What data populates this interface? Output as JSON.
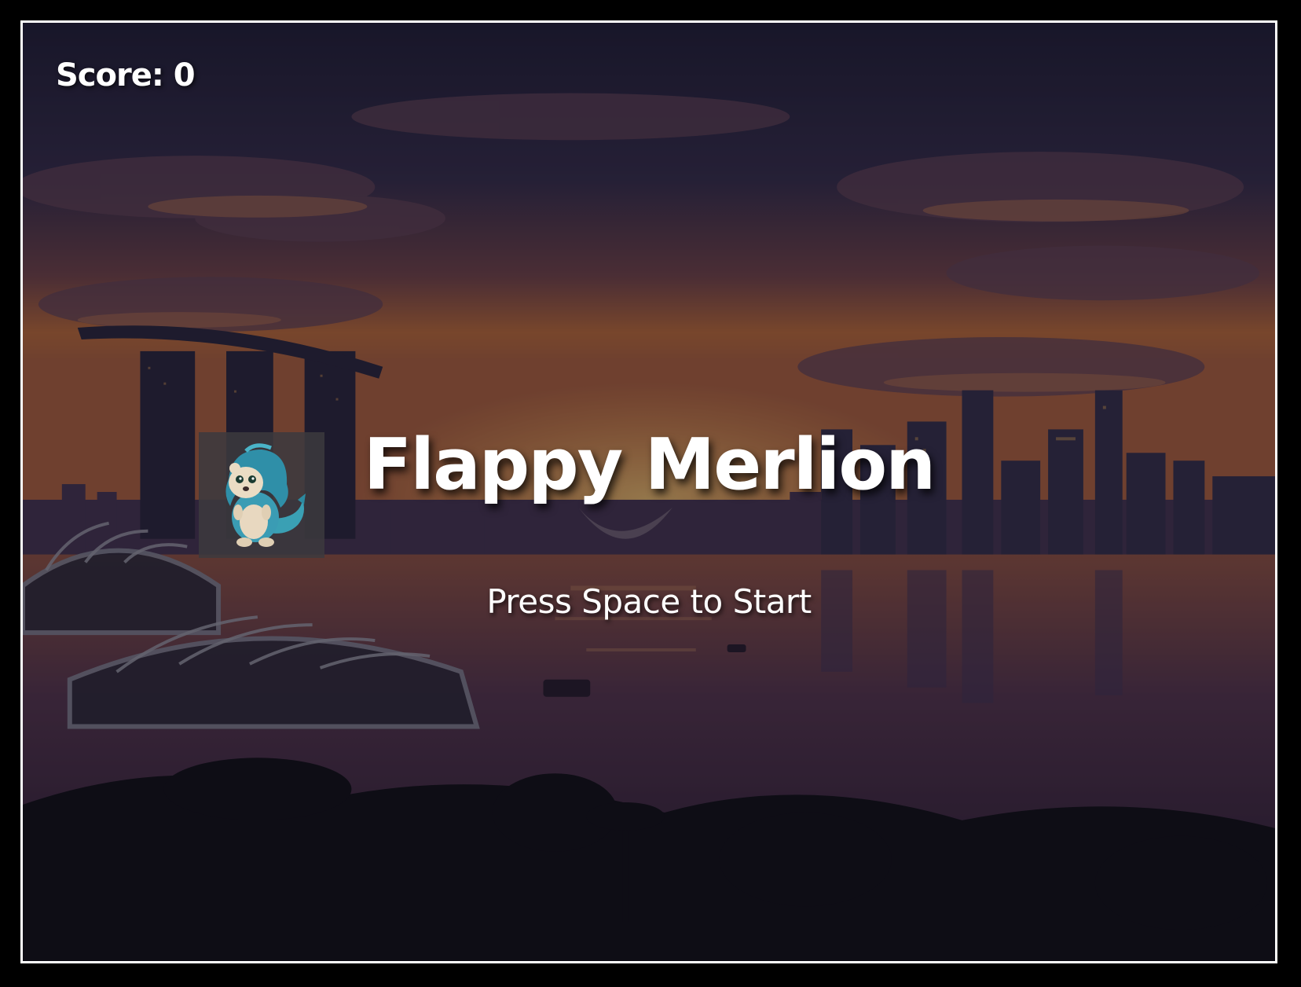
{
  "hud": {
    "score_text": "Score: 0"
  },
  "start_screen": {
    "title": "Flappy Merlion",
    "prompt": "Press Space to Start"
  },
  "player": {
    "icon": "merlion-sprite"
  },
  "background": {
    "scene": "singapore-marina-bay-sunset",
    "colors": {
      "sky_top": "#2a2740",
      "sky_horizon": "#c96a3a",
      "water": "#4a3550",
      "foliage": "#14141c"
    }
  }
}
